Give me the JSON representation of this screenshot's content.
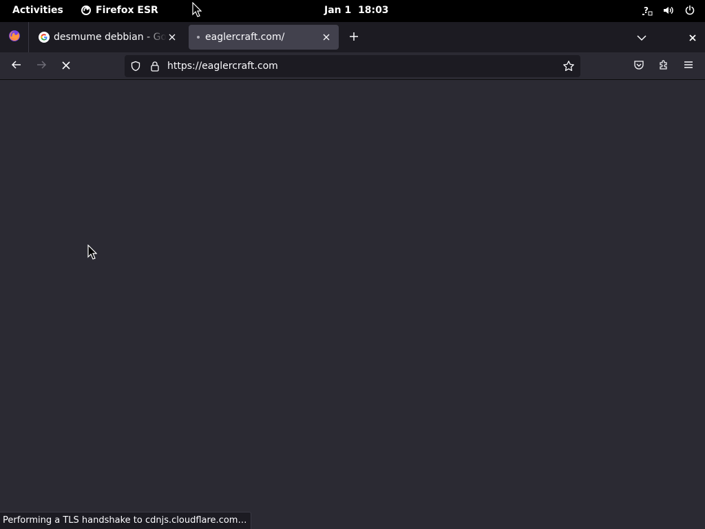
{
  "topbar": {
    "activities": "Activities",
    "app_name": "Firefox ESR",
    "clock": "Jan 1  18:03"
  },
  "tabs": [
    {
      "title": "desmume debbian - Goog",
      "favicon": "google-g-icon",
      "active": false
    },
    {
      "title": "eaglercraft.com/",
      "favicon": "loading-dot",
      "active": true
    }
  ],
  "navbar": {
    "url": "https://eaglercraft.com"
  },
  "status": {
    "text": "Performing a TLS handshake to cdnjs.cloudflare.com…"
  },
  "colors": {
    "topbar_bg": "#000000",
    "tabstrip_bg": "#1c1b22",
    "active_tab_bg": "#42414d",
    "toolbar_bg": "#2b2a33",
    "urlbar_bg": "#1c1b22",
    "content_bg": "#2b2a33"
  }
}
